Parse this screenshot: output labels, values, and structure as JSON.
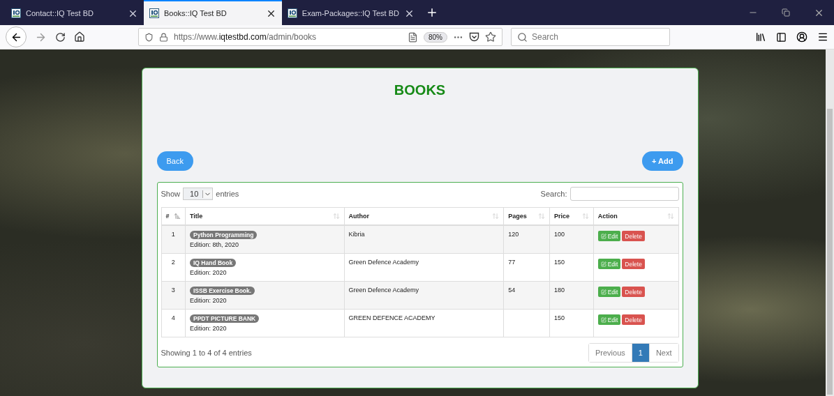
{
  "browser": {
    "tabs": [
      {
        "title": "Contact::IQ Test BD",
        "selected": false
      },
      {
        "title": "Books::IQ Test BD",
        "selected": true
      },
      {
        "title": "Exam-Packages::IQ Test BD",
        "selected": false
      }
    ],
    "url_prefix": "https://www.",
    "url_domain": "iqtestbd.com",
    "url_path": "/admin/books",
    "zoom": "80%",
    "search_placeholder": "Search"
  },
  "page": {
    "heading": "BOOKS",
    "back_button": "Back",
    "add_button": "+ Add",
    "show_label": "Show",
    "page_length": "10",
    "entries_label": "entries",
    "search_label": "Search:",
    "columns": [
      {
        "label": "#",
        "sorted": true
      },
      {
        "label": "Title",
        "sorted": false
      },
      {
        "label": "Author",
        "sorted": false
      },
      {
        "label": "Pages",
        "sorted": false
      },
      {
        "label": "Price",
        "sorted": false
      },
      {
        "label": "Action",
        "sorted": false
      }
    ],
    "rows": [
      {
        "number": "1",
        "title": "Python Programming",
        "edition": "Edition: 8th, 2020",
        "author": "Kibria",
        "pages": "120",
        "price": "100",
        "actions": [
          "Edit",
          "Delete"
        ]
      },
      {
        "number": "2",
        "title": "IQ Hand Book",
        "edition": "Edition: 2020",
        "author": "Green Defence Academy",
        "pages": "77",
        "price": "150",
        "actions": [
          "Edit",
          "Delete"
        ]
      },
      {
        "number": "3",
        "title": "ISSB Exercise Book.",
        "edition": "Edition: 2020",
        "author": "Green Defence Academy",
        "pages": "54",
        "price": "180",
        "actions": [
          "Edit",
          "Delete"
        ]
      },
      {
        "number": "4",
        "title": "PPDT PICTURE BANK",
        "edition": "Edition: 2020",
        "author": "GREEN DEFENCE ACADEMY",
        "price": "150",
        "actions": [
          "Edit",
          "Delete"
        ]
      }
    ],
    "info": "Showing 1 to 4 of 4 entries",
    "pagination": [
      {
        "label": "Previous",
        "selected": false
      },
      {
        "label": "1",
        "selected": true
      },
      {
        "label": "Next",
        "selected": false
      }
    ]
  }
}
